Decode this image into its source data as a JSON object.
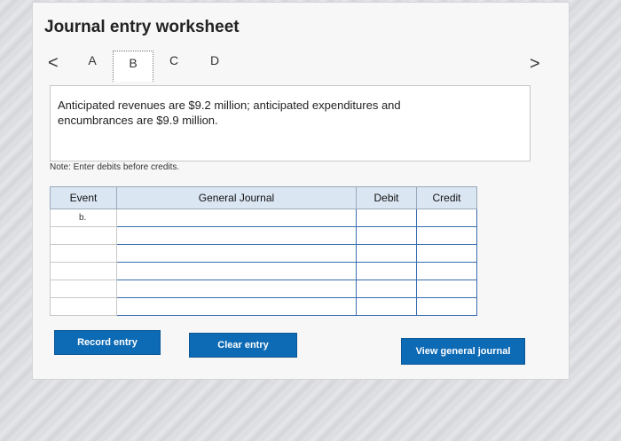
{
  "worksheet": {
    "title": "Journal entry worksheet",
    "tabs": [
      "A",
      "B",
      "C",
      "D"
    ],
    "active_tab": "B",
    "prev_arrow": "<",
    "next_arrow": ">",
    "description": "Anticipated revenues are $9.2 million; anticipated expenditures and encumbrances are $9.9 million.",
    "note": "Note: Enter debits before credits."
  },
  "table": {
    "headers": {
      "event": "Event",
      "general_journal": "General Journal",
      "debit": "Debit",
      "credit": "Credit"
    },
    "rows": [
      {
        "event": "b."
      },
      {
        "event": ""
      },
      {
        "event": ""
      },
      {
        "event": ""
      },
      {
        "event": ""
      },
      {
        "event": ""
      }
    ]
  },
  "buttons": {
    "record": "Record entry",
    "clear": "Clear entry",
    "view": "View general journal"
  },
  "colors": {
    "button": "#0d6ab5",
    "header": "#dbe6f3",
    "input_border": "#3a6db0"
  }
}
